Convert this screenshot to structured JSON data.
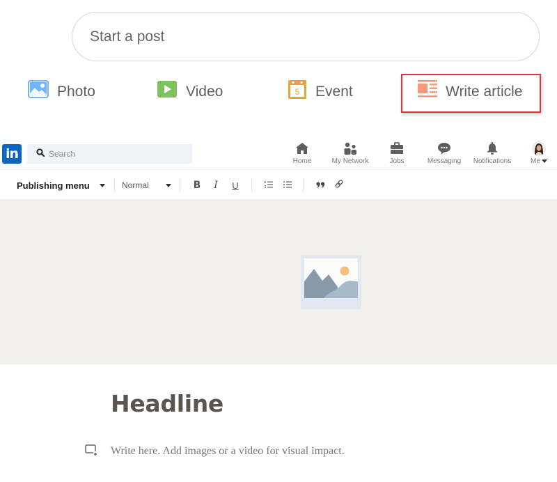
{
  "composer": {
    "start_post_placeholder": "Start a post",
    "actions": [
      {
        "label": "Photo",
        "icon": "photo-icon",
        "color": "#70b5f9"
      },
      {
        "label": "Video",
        "icon": "video-icon",
        "color": "#7fc15e"
      },
      {
        "label": "Event",
        "icon": "event-icon",
        "color": "#e7a33e",
        "day": "5"
      },
      {
        "label": "Write article",
        "icon": "article-icon",
        "color": "#f5987e",
        "highlighted": true
      }
    ],
    "highlight_color": "#e0343f"
  },
  "nav": {
    "logo": "in",
    "brand_color": "#0a66c2",
    "search_placeholder": "Search",
    "items": [
      {
        "label": "Home",
        "icon": "home-icon"
      },
      {
        "label": "My Network",
        "icon": "network-icon"
      },
      {
        "label": "Jobs",
        "icon": "briefcase-icon"
      },
      {
        "label": "Messaging",
        "icon": "messaging-icon"
      },
      {
        "label": "Notifications",
        "icon": "bell-icon"
      },
      {
        "label": "Me",
        "icon": "avatar"
      }
    ]
  },
  "toolbar": {
    "publishing_menu": "Publishing menu",
    "text_style": "Normal",
    "bold": "B",
    "italic": "I",
    "underline": "U"
  },
  "editor": {
    "headline_placeholder": "Headline",
    "body_placeholder": "Write here. Add images or a video for visual impact."
  }
}
